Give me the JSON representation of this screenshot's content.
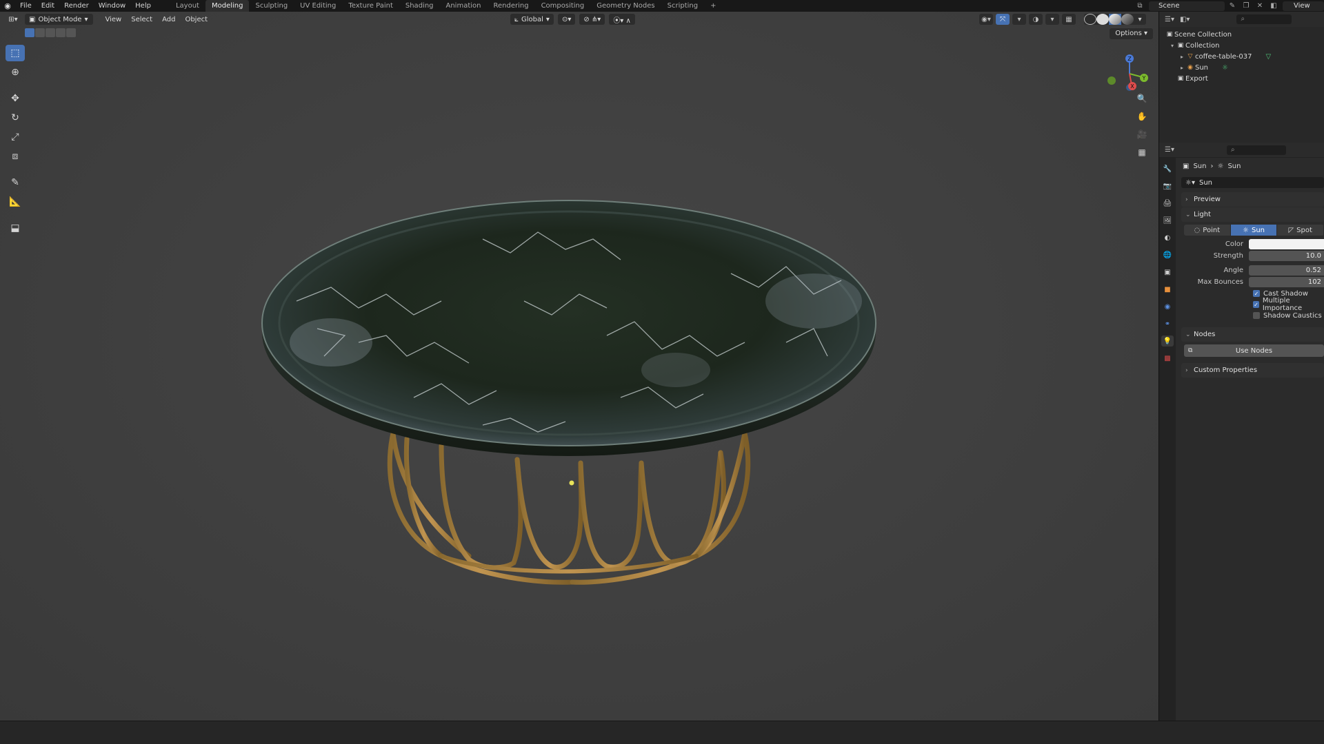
{
  "topbar": {
    "menus": [
      "File",
      "Edit",
      "Render",
      "Window",
      "Help"
    ],
    "workspaces": [
      "Layout",
      "Modeling",
      "Sculpting",
      "UV Editing",
      "Texture Paint",
      "Shading",
      "Animation",
      "Rendering",
      "Compositing",
      "Geometry Nodes",
      "Scripting"
    ],
    "active_workspace": "Modeling",
    "scene_name": "Scene",
    "view_layer": "View"
  },
  "viewport": {
    "mode": "Object Mode",
    "menus": [
      "View",
      "Select",
      "Add",
      "Object"
    ],
    "transform_orientation": "Global",
    "options_label": "Options",
    "gizmo_axes": [
      "Z",
      "Y",
      "X"
    ]
  },
  "outliner": {
    "items": [
      {
        "label": "Scene Collection",
        "icon": "collection-icon"
      },
      {
        "label": "Collection",
        "icon": "collection-icon"
      },
      {
        "label": "coffee-table-037",
        "icon": "mesh-icon"
      },
      {
        "label": "Sun",
        "icon": "sun-light-icon"
      },
      {
        "label": "Export",
        "icon": "collection-icon"
      }
    ]
  },
  "properties": {
    "breadcrumb": [
      "Sun",
      "Sun"
    ],
    "data_name": "Sun",
    "panels": {
      "preview": "Preview",
      "light": "Light",
      "nodes": "Nodes",
      "custom": "Custom Properties"
    },
    "light_types": [
      "Point",
      "Sun",
      "Spot"
    ],
    "active_light_type": "Sun",
    "fields": {
      "color_label": "Color",
      "strength_label": "Strength",
      "strength_value": "10.0",
      "angle_label": "Angle",
      "angle_value": "0.52",
      "max_bounces_label": "Max Bounces",
      "max_bounces_value": "102"
    },
    "checkboxes": [
      {
        "label": "Cast Shadow",
        "checked": true
      },
      {
        "label": "Multiple Importance",
        "checked": true
      },
      {
        "label": "Shadow Caustics",
        "checked": false
      }
    ],
    "use_nodes_label": "Use Nodes"
  },
  "colors": {
    "accent": "#4772b3",
    "table_top": "#1f2a1f",
    "table_legs": "#b0873f"
  }
}
